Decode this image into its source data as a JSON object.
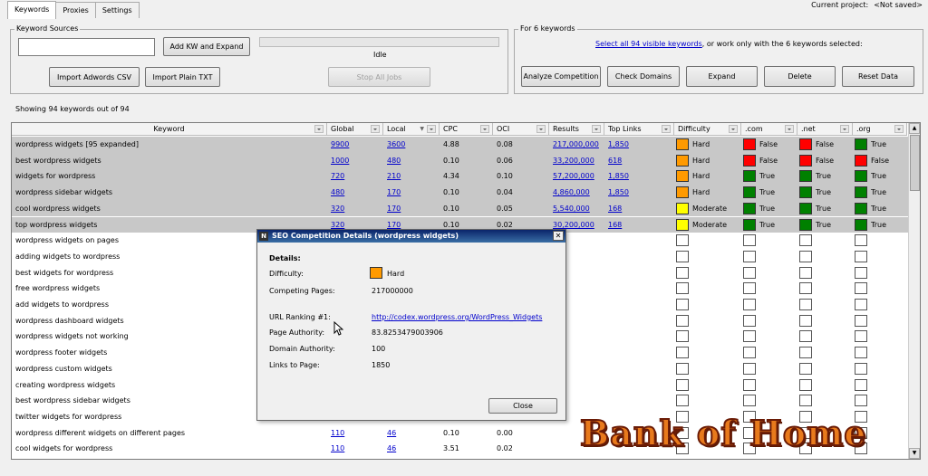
{
  "tabs": [
    "Keywords",
    "Proxies",
    "Settings"
  ],
  "project": {
    "label": "Current project:",
    "value": "<Not saved>"
  },
  "sources": {
    "legend": "Keyword Sources",
    "add_button": "Add KW and Expand",
    "status": "Idle",
    "import_csv": "Import Adwords CSV",
    "import_txt": "Import Plain TXT",
    "stop_all": "Stop All Jobs"
  },
  "actions": {
    "legend": "For 6 keywords",
    "select_link": "Select all 94 visible keywords",
    "select_rest": ", or work only with the 6 keywords selected:",
    "analyze": "Analyze Competition",
    "check_domains": "Check Domains",
    "expand": "Expand",
    "delete": "Delete",
    "reset": "Reset Data"
  },
  "showing": "Showing 94 keywords out of 94",
  "columns": [
    "Keyword",
    "Global",
    "Local",
    "CPC",
    "OCI",
    "Results",
    "Top Links",
    "Difficulty",
    ".com",
    ".net",
    ".org"
  ],
  "colors": {
    "hard": "#ff9a00",
    "moderate": "#ffff00",
    "false": "#ff0000",
    "true": "#008000",
    "highlight": "#c8c8c8"
  },
  "rows": [
    {
      "kw": "wordpress widgets [95 expanded]",
      "global": "9900",
      "local": "3600",
      "cpc": "4.88",
      "oci": "0.08",
      "results": "217,000,000",
      "top": "1,850",
      "diff": "Hard",
      "com": "False",
      "net": "False",
      "org": "True",
      "hl": true
    },
    {
      "kw": "best wordpress widgets",
      "global": "1000",
      "local": "480",
      "cpc": "0.10",
      "oci": "0.06",
      "results": "33,200,000",
      "top": "618",
      "diff": "Hard",
      "com": "False",
      "net": "False",
      "org": "False",
      "hl": true
    },
    {
      "kw": "widgets for wordpress",
      "global": "720",
      "local": "210",
      "cpc": "4.34",
      "oci": "0.10",
      "results": "57,200,000",
      "top": "1,850",
      "diff": "Hard",
      "com": "True",
      "net": "True",
      "org": "True",
      "hl": true
    },
    {
      "kw": "wordpress sidebar widgets",
      "global": "480",
      "local": "170",
      "cpc": "0.10",
      "oci": "0.04",
      "results": "4,860,000",
      "top": "1,850",
      "diff": "Hard",
      "com": "True",
      "net": "True",
      "org": "True",
      "hl": true
    },
    {
      "kw": "cool wordpress widgets",
      "global": "320",
      "local": "170",
      "cpc": "0.10",
      "oci": "0.05",
      "results": "5,540,000",
      "top": "168",
      "diff": "Moderate",
      "com": "True",
      "net": "True",
      "org": "True",
      "hl": true
    },
    {
      "kw": "top wordpress widgets",
      "global": "320",
      "local": "170",
      "cpc": "0.10",
      "oci": "0.02",
      "results": "30,200,000",
      "top": "168",
      "diff": "Moderate",
      "com": "True",
      "net": "True",
      "org": "True",
      "hl": true
    },
    {
      "kw": "wordpress widgets on pages"
    },
    {
      "kw": "adding widgets to wordpress"
    },
    {
      "kw": "best widgets for wordpress"
    },
    {
      "kw": "free wordpress widgets"
    },
    {
      "kw": "add widgets to wordpress"
    },
    {
      "kw": "wordpress dashboard widgets"
    },
    {
      "kw": "wordpress widgets not working"
    },
    {
      "kw": "wordpress footer widgets"
    },
    {
      "kw": "wordpress custom widgets"
    },
    {
      "kw": "creating wordpress widgets"
    },
    {
      "kw": "best wordpress sidebar widgets"
    },
    {
      "kw": "twitter widgets for wordpress"
    },
    {
      "kw": "wordpress different widgets on different pages",
      "global": "110",
      "local": "46",
      "cpc": "0.10",
      "oci": "0.00"
    },
    {
      "kw": "cool widgets for wordpress",
      "global": "110",
      "local": "46",
      "cpc": "3.51",
      "oci": "0.02"
    }
  ],
  "dialog": {
    "title": "SEO Competition Details (wordpress widgets)",
    "heading": "Details:",
    "difficulty_label": "Difficulty:",
    "difficulty_value": "Hard",
    "competing_label": "Competing Pages:",
    "competing_value": "217000000",
    "url_label": "URL Ranking #1:",
    "url_value": "http://codex.wordpress.org/WordPress_Widgets",
    "pa_label": "Page Authority:",
    "pa_value": "83.8253479003906",
    "da_label": "Domain Authority:",
    "da_value": "100",
    "links_label": "Links to Page:",
    "links_value": "1850",
    "close": "Close"
  },
  "brand": "Bank of Home"
}
